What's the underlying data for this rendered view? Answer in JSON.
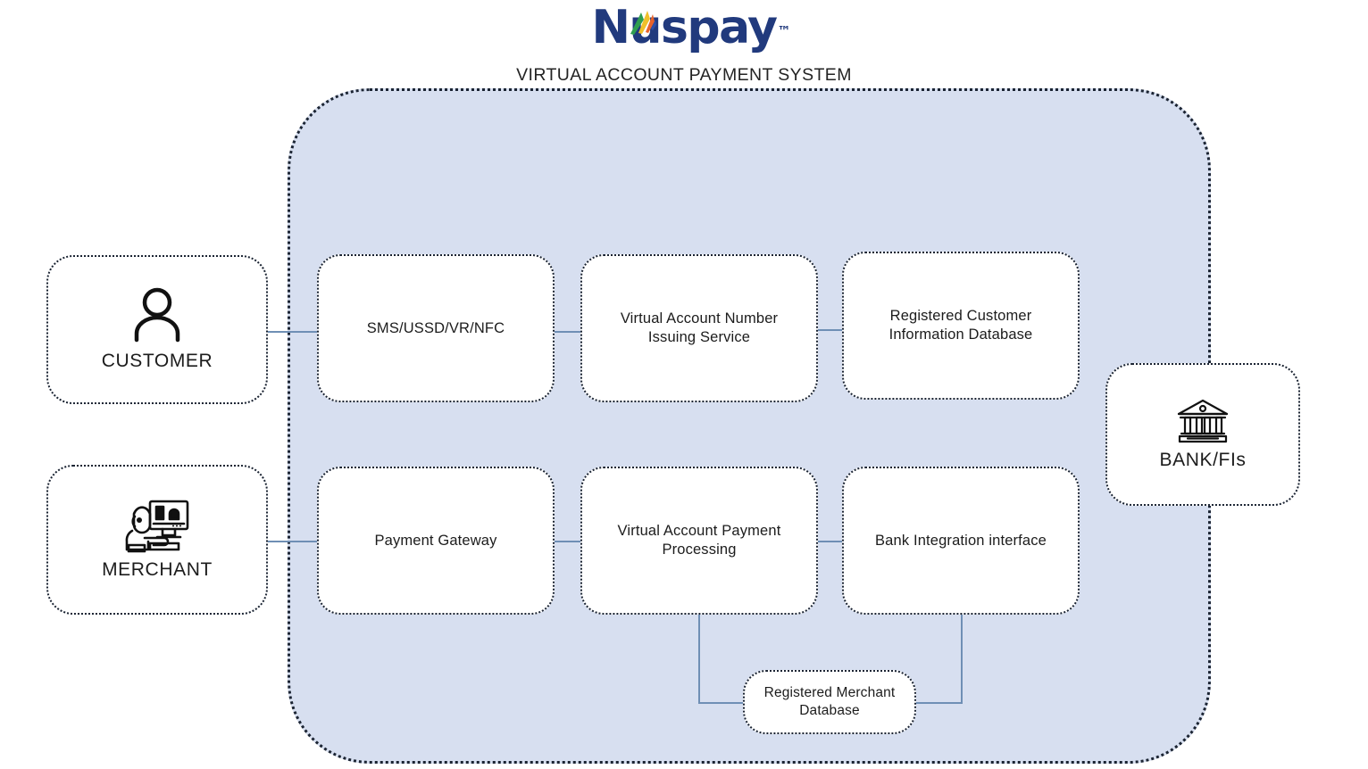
{
  "header": {
    "logo_text": "Nuspay",
    "logo_trademark": "™",
    "logo_icon": "nuspay-leaf-mark",
    "subtitle": "VIRTUAL ACCOUNT PAYMENT SYSTEM"
  },
  "container": {
    "name": "virtual-account-payment-system-boundary",
    "fill": "#d7dff0",
    "border_color": "#1b2433"
  },
  "actors": [
    {
      "id": "customer",
      "label": "CUSTOMER",
      "icon": "person-icon"
    },
    {
      "id": "merchant",
      "label": "MERCHANT",
      "icon": "merchant-workstation-icon"
    },
    {
      "id": "bank",
      "label": "BANK/FIs",
      "icon": "bank-building-icon"
    }
  ],
  "modules": {
    "top_row": [
      {
        "id": "sms",
        "label": "SMS/USSD/VR/NFC"
      },
      {
        "id": "van",
        "label": "Virtual Account Number Issuing Service"
      },
      {
        "id": "rcid",
        "label": "Registered Customer Information Database"
      }
    ],
    "bottom_row": [
      {
        "id": "gateway",
        "label": "Payment Gateway"
      },
      {
        "id": "vapp",
        "label": "Virtual Account Payment Processing"
      },
      {
        "id": "bii",
        "label": "Bank Integration interface"
      }
    ],
    "database": {
      "id": "rmd",
      "label": "Registered Merchant Database"
    }
  },
  "connector_color": "#6f8fb5"
}
